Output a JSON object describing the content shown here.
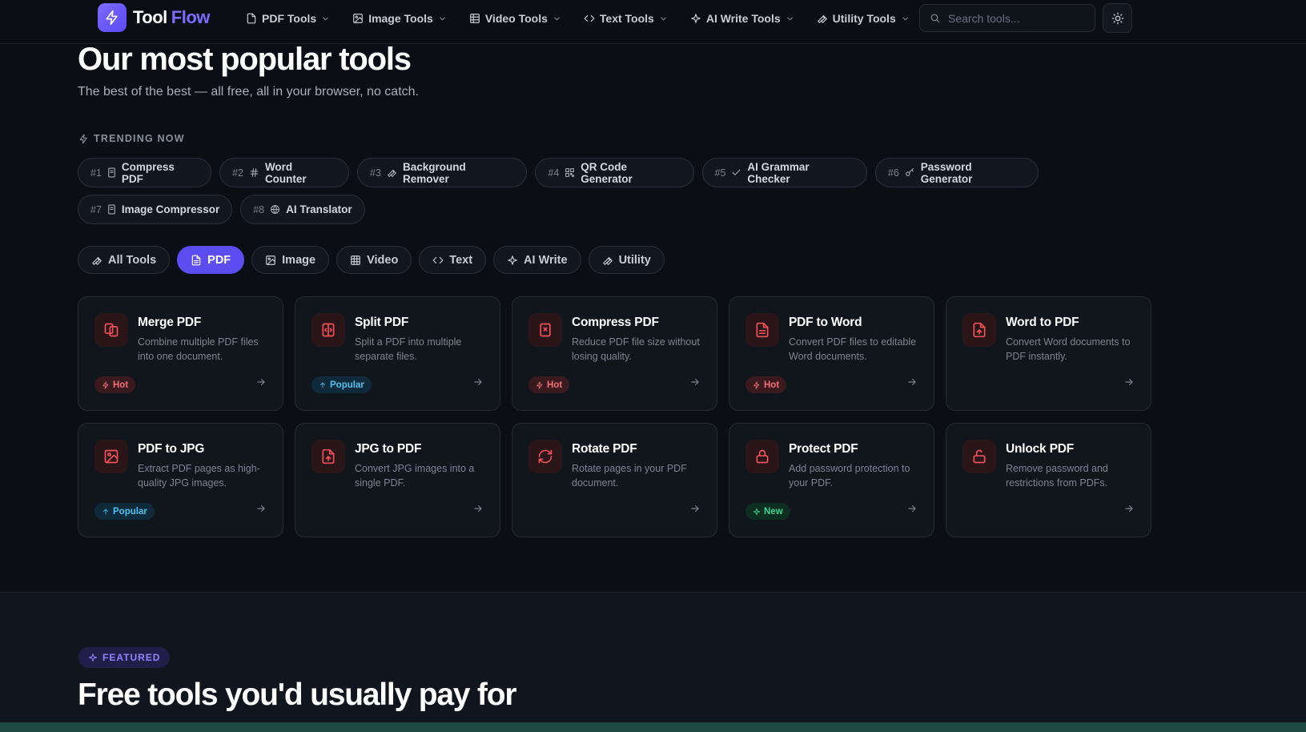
{
  "brand": {
    "name_part1": "Tool",
    "name_part2": "Flow",
    "accent": "#5b4df0"
  },
  "nav": {
    "items": [
      {
        "label": "PDF Tools",
        "icon": "file-icon"
      },
      {
        "label": "Image Tools",
        "icon": "image-icon"
      },
      {
        "label": "Video Tools",
        "icon": "video-grid-icon"
      },
      {
        "label": "Text Tools",
        "icon": "code-icon"
      },
      {
        "label": "AI Write Tools",
        "icon": "sparkle-icon"
      },
      {
        "label": "Utility Tools",
        "icon": "wrench-icon"
      }
    ],
    "search_placeholder": "Search tools...",
    "theme_toggle_icon": "sun-icon"
  },
  "hero": {
    "title": "Our most popular tools",
    "subtitle": "The best of the best — all free, all in your browser, no catch."
  },
  "trending": {
    "label": "TRENDING NOW",
    "items": [
      {
        "rank": "#1",
        "label": "Compress PDF",
        "icon": "file-small-icon"
      },
      {
        "rank": "#2",
        "label": "Word Counter",
        "icon": "hash-icon"
      },
      {
        "rank": "#3",
        "label": "Background Remover",
        "icon": "wrench-icon"
      },
      {
        "rank": "#4",
        "label": "QR Code Generator",
        "icon": "qr-code-icon"
      },
      {
        "rank": "#5",
        "label": "AI Grammar Checker",
        "icon": "check-icon"
      },
      {
        "rank": "#6",
        "label": "Password Generator",
        "icon": "key-icon"
      },
      {
        "rank": "#7",
        "label": "Image Compressor",
        "icon": "file-small-icon"
      },
      {
        "rank": "#8",
        "label": "AI Translator",
        "icon": "globe-icon"
      }
    ]
  },
  "filters": {
    "active": "PDF",
    "items": [
      {
        "label": "All Tools",
        "icon": "wrench-icon"
      },
      {
        "label": "PDF",
        "icon": "file-icon"
      },
      {
        "label": "Image",
        "icon": "image-icon"
      },
      {
        "label": "Video",
        "icon": "video-grid-icon"
      },
      {
        "label": "Text",
        "icon": "code-icon"
      },
      {
        "label": "AI Write",
        "icon": "sparkle-icon"
      },
      {
        "label": "Utility",
        "icon": "wrench-icon"
      }
    ]
  },
  "tools": [
    {
      "title": "Merge PDF",
      "desc": "Combine multiple PDF files into one document.",
      "badge": "Hot",
      "icon": "merge-files-icon"
    },
    {
      "title": "Split PDF",
      "desc": "Split a PDF into multiple separate files.",
      "badge": "Popular",
      "icon": "split-icon"
    },
    {
      "title": "Compress PDF",
      "desc": "Reduce PDF file size without losing quality.",
      "badge": "Hot",
      "icon": "compress-file-icon"
    },
    {
      "title": "PDF to Word",
      "desc": "Convert PDF files to editable Word documents.",
      "badge": "Hot",
      "icon": "document-icon"
    },
    {
      "title": "Word to PDF",
      "desc": "Convert Word documents to PDF instantly.",
      "badge": "",
      "icon": "file-upload-icon"
    },
    {
      "title": "PDF to JPG",
      "desc": "Extract PDF pages as high-quality JPG images.",
      "badge": "Popular",
      "icon": "image-icon"
    },
    {
      "title": "JPG to PDF",
      "desc": "Convert JPG images into a single PDF.",
      "badge": "",
      "icon": "file-upload-icon"
    },
    {
      "title": "Rotate PDF",
      "desc": "Rotate pages in your PDF document.",
      "badge": "",
      "icon": "rotate-icon"
    },
    {
      "title": "Protect PDF",
      "desc": "Add password protection to your PDF.",
      "badge": "New",
      "icon": "lock-icon"
    },
    {
      "title": "Unlock PDF",
      "desc": "Remove password and restrictions from PDFs.",
      "badge": "",
      "icon": "unlock-icon"
    }
  ],
  "featured": {
    "badge": "FEATURED",
    "title": "Free tools you'd usually pay for"
  },
  "colors": {
    "background": "#0b0e14",
    "card": "#11151c",
    "hot": "#f2707a",
    "popular": "#4fc1f0",
    "new": "#3ed492",
    "tool_icon": "#f0505a"
  }
}
